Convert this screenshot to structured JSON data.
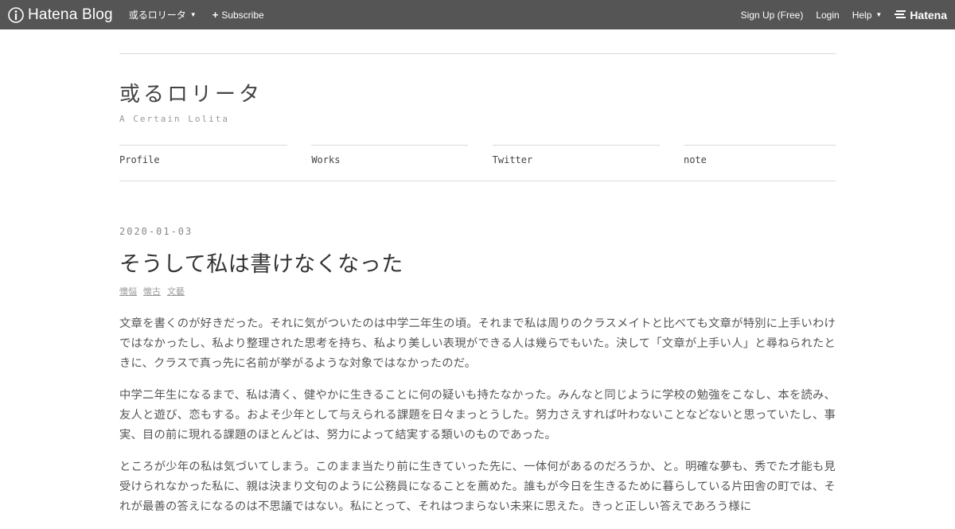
{
  "globalbar": {
    "logo_text": "Hatena Blog",
    "blog_menu": "或るロリータ",
    "subscribe": "Subscribe",
    "signup": "Sign Up (Free)",
    "login": "Login",
    "help": "Help",
    "hatena": "Hatena",
    "bg_color": "#555555"
  },
  "header": {
    "title": "或るロリータ",
    "subtitle": "A Certain Lolita"
  },
  "nav": {
    "items": [
      {
        "label": "Profile"
      },
      {
        "label": "Works"
      },
      {
        "label": "Twitter"
      },
      {
        "label": "note"
      }
    ]
  },
  "entry": {
    "date": "2020-01-03",
    "title": "そうして私は書けなくなった",
    "categories": [
      "懊悩",
      "懐古",
      "文藝"
    ],
    "paragraphs": [
      "文章を書くのが好きだった。それに気がついたのは中学二年生の頃。それまで私は周りのクラスメイトと比べても文章が特別に上手いわけではなかったし、私より整理された思考を持ち、私より美しい表現ができる人は幾らでもいた。決して「文章が上手い人」と尋ねられたときに、クラスで真っ先に名前が挙がるような対象ではなかったのだ。",
      "中学二年生になるまで、私は清く、健やかに生きることに何の疑いも持たなかった。みんなと同じように学校の勉強をこなし、本を読み、友人と遊び、恋もする。およそ少年として与えられる課題を日々まっとうした。努力さえすれば叶わないことなどないと思っていたし、事実、目の前に現れる課題のほとんどは、努力によって結実する類いのものであった。",
      "ところが少年の私は気づいてしまう。このまま当たり前に生きていった先に、一体何があるのだろうか、と。明確な夢も、秀でた才能も見受けられなかった私に、親は決まり文句のように公務員になることを薦めた。誰もが今日を生きるために暮らしている片田舎の町では、それが最善の答えになるのは不思議ではない。私にとって、それはつまらない未来に思えた。きっと正しい答えであろう様に"
    ]
  }
}
